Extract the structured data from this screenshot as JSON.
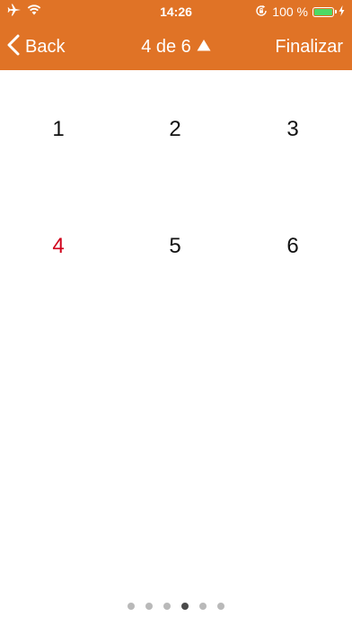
{
  "status_bar": {
    "time": "14:26",
    "battery_text": "100 %",
    "icons": [
      "airplane-icon",
      "wifi-icon",
      "rotation-lock-icon",
      "battery-icon",
      "charging-icon"
    ]
  },
  "nav": {
    "back_label": "Back",
    "title": "4 de 6",
    "title_icon": "triangle-up-icon",
    "finalizar_label": "Finalizar"
  },
  "grid": {
    "items": [
      "1",
      "2",
      "3",
      "4",
      "5",
      "6"
    ],
    "active_index": 3
  },
  "page_control": {
    "count": 6,
    "current": 4
  },
  "colors": {
    "bar": "#e07326",
    "active_number": "#d0021b",
    "battery_fill": "#4cd964",
    "dot": "#b9b9b9",
    "dot_current": "#4a4a4a"
  }
}
